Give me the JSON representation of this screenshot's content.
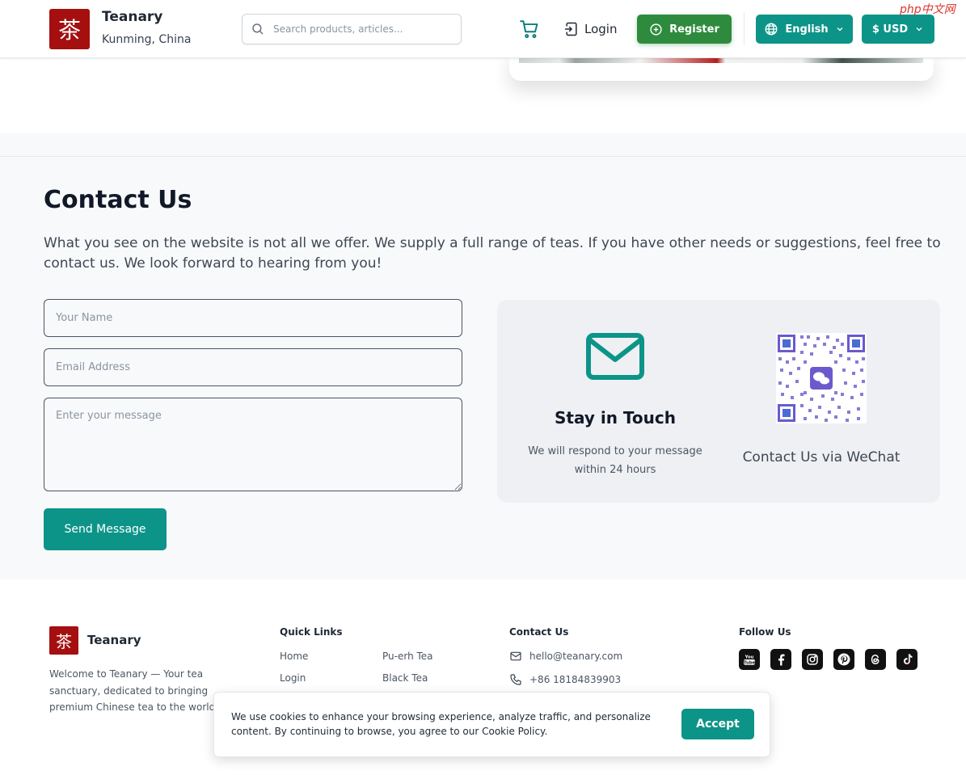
{
  "header": {
    "logo_char": "茶",
    "brand": "Teanary",
    "location": "Kunming, China",
    "search_placeholder": "Search products, articles...",
    "login_label": "Login",
    "register_label": "Register",
    "language_label": "English",
    "currency_label": "$ USD",
    "watermark": "php中文网"
  },
  "contact": {
    "title": "Contact Us",
    "description": "What you see on the website is not all we offer. We supply a full range of teas. If you have other needs or suggestions, feel free to contact us. We look forward to hearing from you!",
    "name_placeholder": "Your Name",
    "email_placeholder": "Email Address",
    "message_placeholder": "Enter your message",
    "send_label": "Send Message",
    "card": {
      "touch_title": "Stay in Touch",
      "touch_sub": "We will respond to your message within 24 hours",
      "wechat_label": "Contact Us via WeChat"
    }
  },
  "footer": {
    "logo_char": "茶",
    "brand": "Teanary",
    "about": "Welcome to Teanary — Your tea sanctuary, dedicated to bringing premium Chinese tea to the world.",
    "quick_links_title": "Quick Links",
    "quick_links": [
      "Home",
      "Login",
      "Pu-erh Tea",
      "Black Tea"
    ],
    "contact_title": "Contact Us",
    "email": "hello@teanary.com",
    "phone": "+86 18184839903",
    "follow_title": "Follow Us",
    "socials": [
      "youtube-icon",
      "facebook-icon",
      "instagram-icon",
      "pinterest-icon",
      "threads-icon",
      "tiktok-icon"
    ]
  },
  "cookie": {
    "text": "We use cookies to enhance your browsing experience, analyze traffic, and personalize content. By continuing to browse, you agree to our Cookie Policy.",
    "accept_label": "Accept"
  },
  "colors": {
    "brand_red": "#a50f0f",
    "teal": "#0d9488",
    "green": "#2e8b3e"
  }
}
